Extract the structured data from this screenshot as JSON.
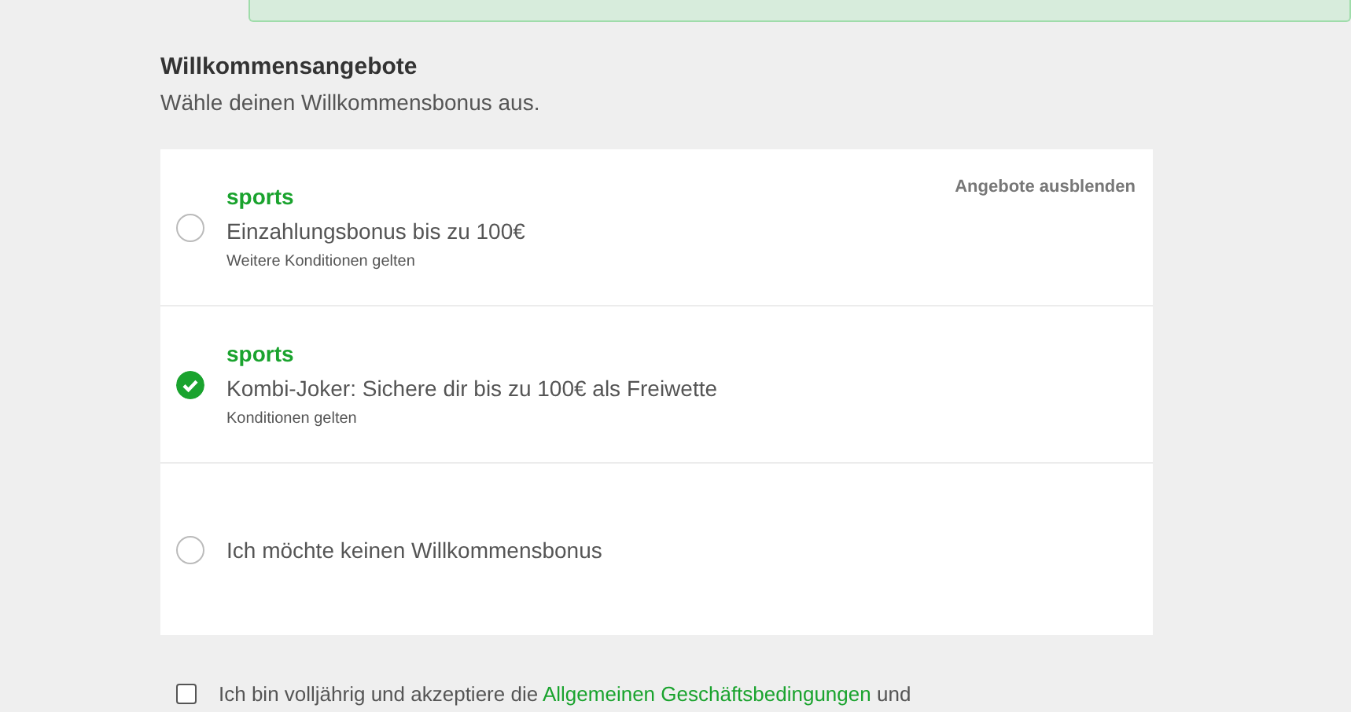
{
  "section": {
    "title": "Willkommensangebote",
    "subtitle": "Wähle deinen Willkommensbonus aus."
  },
  "offers": {
    "hide_link": "Angebote ausblenden",
    "items": [
      {
        "brand": "sports",
        "title": "Einzahlungsbonus bis zu 100€",
        "terms": "Weitere Konditionen gelten",
        "selected": false
      },
      {
        "brand": "sports",
        "title": "Kombi-Joker: Sichere dir bis zu 100€ als Freiwette",
        "terms": "Konditionen gelten",
        "selected": true
      },
      {
        "title": "Ich möchte keinen Willkommensbonus",
        "selected": false
      }
    ]
  },
  "consent": {
    "checked": false,
    "text_before": "Ich bin volljährig und akzeptiere die",
    "link": "Allgemeinen Geschäftsbedingungen",
    "text_after": "und"
  }
}
